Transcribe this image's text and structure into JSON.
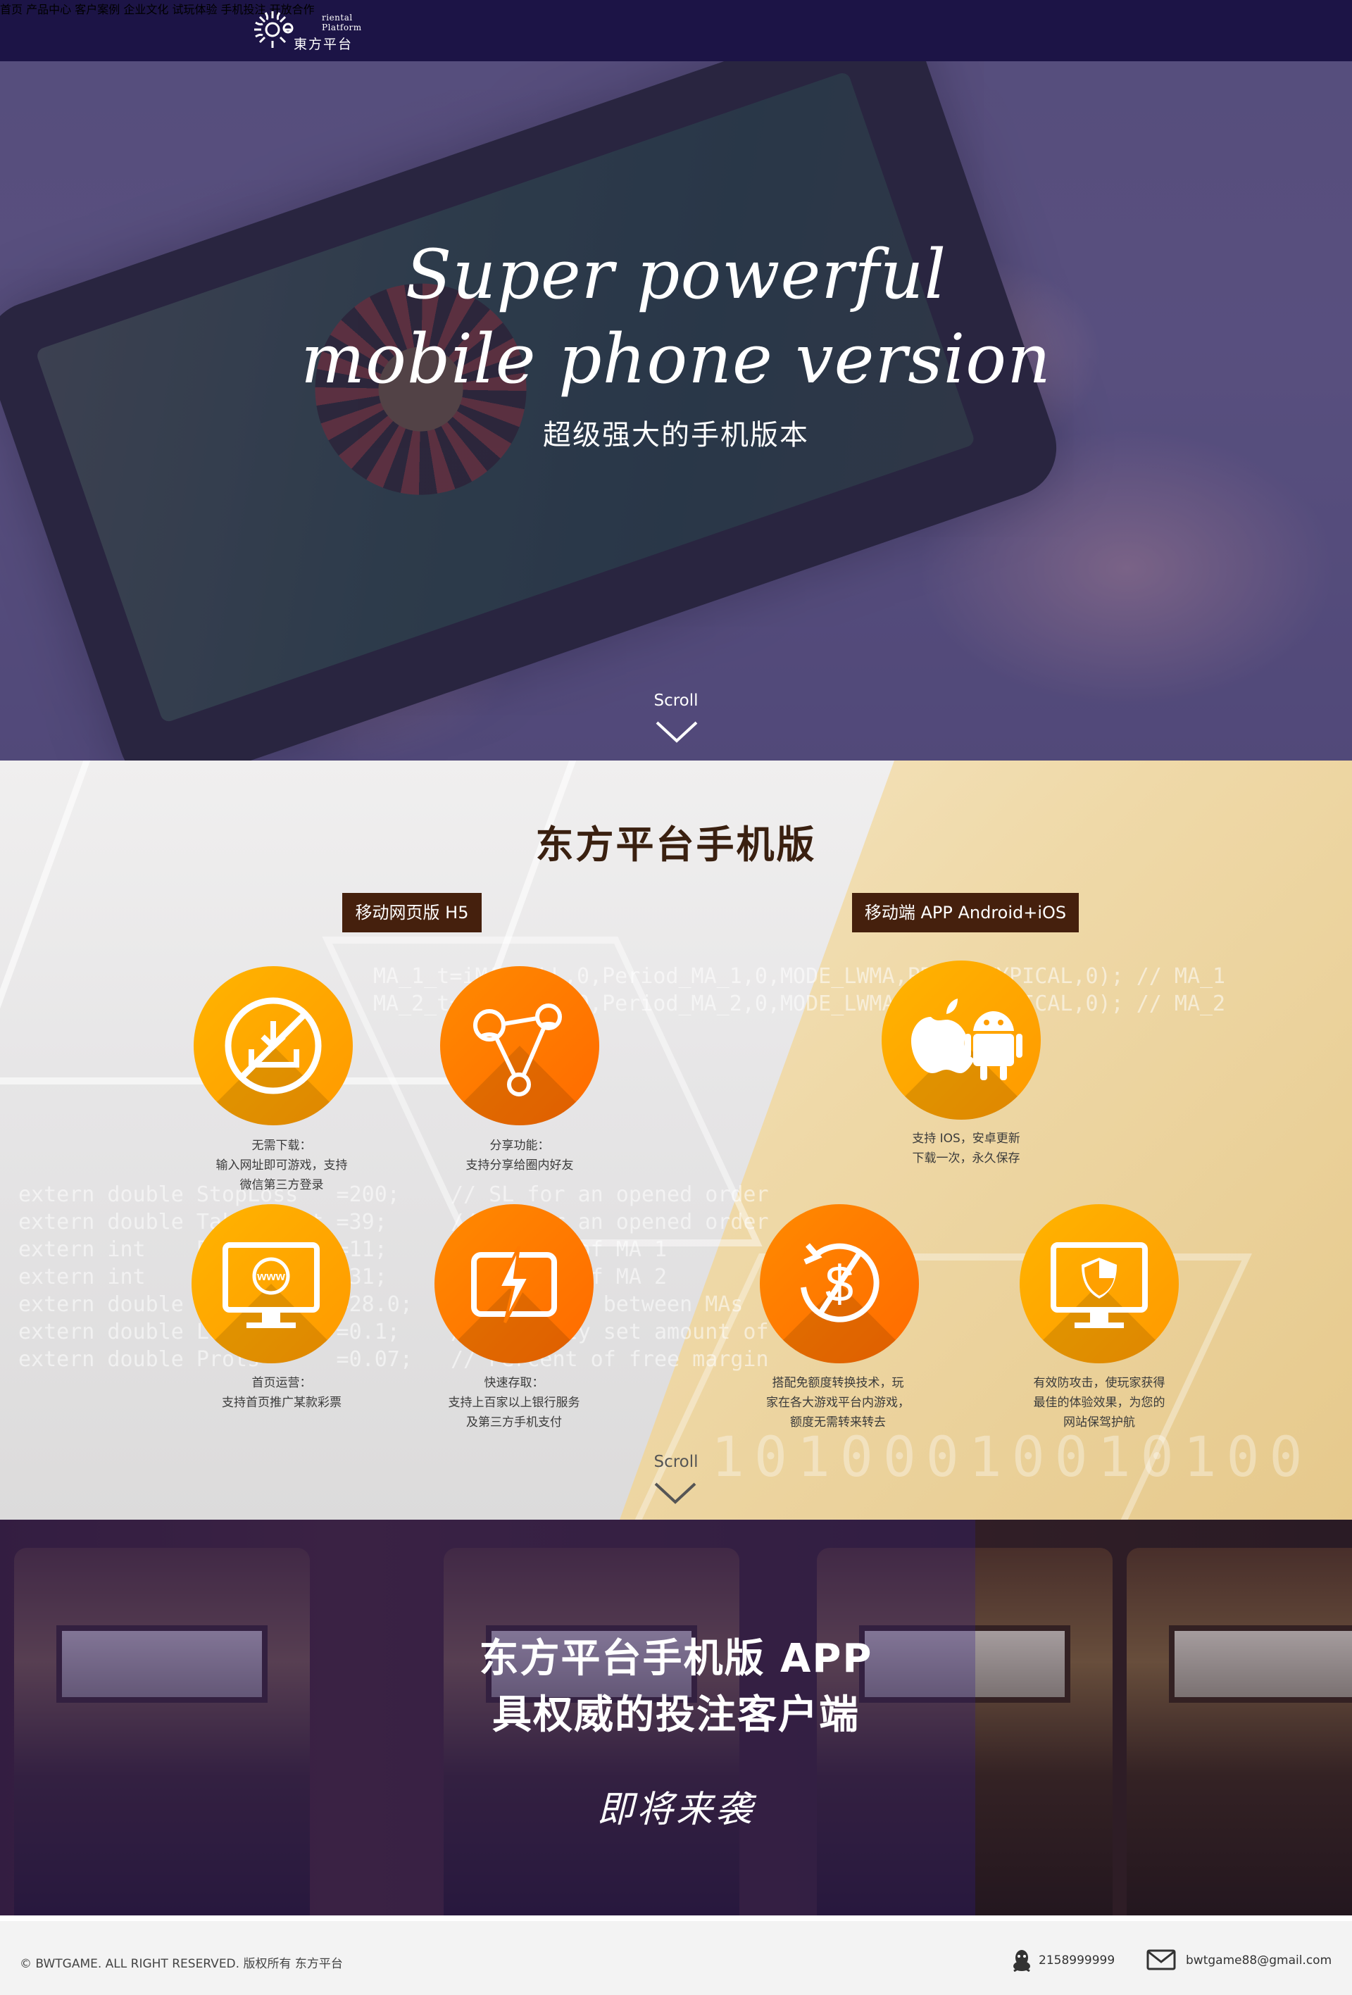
{
  "nav": {
    "logo_en": "riental Platform",
    "logo_cn": "東方平台",
    "items": [
      "首页",
      "产品中心",
      "客户案例",
      "企业文化",
      "试玩体验",
      "手机投注",
      "开放合作"
    ]
  },
  "hero": {
    "title_line1": "Super powerful",
    "title_line2": "mobile phone version",
    "subtitle": "超级强大的手机版本",
    "scroll": "Scroll"
  },
  "features": {
    "title": "东方平台手机版",
    "tag_h5": "移动网页版 H5",
    "tag_app": "移动端 APP  Android+iOS",
    "scroll": "Scroll",
    "items": [
      {
        "icon": "no-download-icon",
        "caption": [
          "无需下载：",
          "输入网址即可游戏，支持",
          "微信第三方登录"
        ]
      },
      {
        "icon": "share-network-icon",
        "caption": [
          "分享功能：",
          "支持分享给圈内好友"
        ]
      },
      {
        "icon": "apple-android-icon",
        "caption": [
          "支持 IOS，安卓更新",
          "下载一次，永久保存"
        ]
      },
      {
        "icon": "www-monitor-icon",
        "caption": [
          "首页运营：",
          "支持首页推广某款彩票"
        ]
      },
      {
        "icon": "lightning-card-icon",
        "caption": [
          "快速存取：",
          "支持上百家以上银行服务",
          "及第三方手机支付"
        ]
      },
      {
        "icon": "no-transfer-icon",
        "caption": [
          "搭配免额度转换技术，玩",
          "家在各大游戏平台内游戏，",
          "额度无需转来转去"
        ]
      },
      {
        "icon": "shield-monitor-icon",
        "caption": [
          "有效防攻击，使玩家获得",
          "最佳的体验效果，为您的",
          "网站保驾护航"
        ]
      }
    ],
    "code_left": "extern double StopLoss   =200;\nextern double TakeProfit =39;\nextern int    Period_MA_1=11;\nextern int    Period_MA_2=31;\nextern double Rastvor    =28.0;\nextern double Lots       =0.1;\nextern double Prots      =0.07;",
    "code_mid": "// SL for an opened order\n// TP for an opened order\n// Period of MA 1\n// Period of MA 2\n// Distance between MAs\n// Strictly set amount of\n// Percent of free margin",
    "code_top": "MA_1_t=iMA(NULL,0,Period_MA_1,0,MODE_LWMA,PRICE_TYPICAL,0); // MA_1\nMA_2_t=iMA(NULL,0,Period_MA_2,0,MODE_LWMA,PRICE_TYPICAL,0); // MA_2",
    "bits": "10100010010100"
  },
  "app": {
    "line1": "东方平台手机版 APP",
    "line2": "具权威的投注客户端",
    "line3": "即将来袭"
  },
  "footer": {
    "copyright": "© BWTGAME. ALL RIGHT RESERVED. 版权所有 东方平台",
    "qq": "2158999999",
    "email": "bwtgame88@gmail.com"
  }
}
